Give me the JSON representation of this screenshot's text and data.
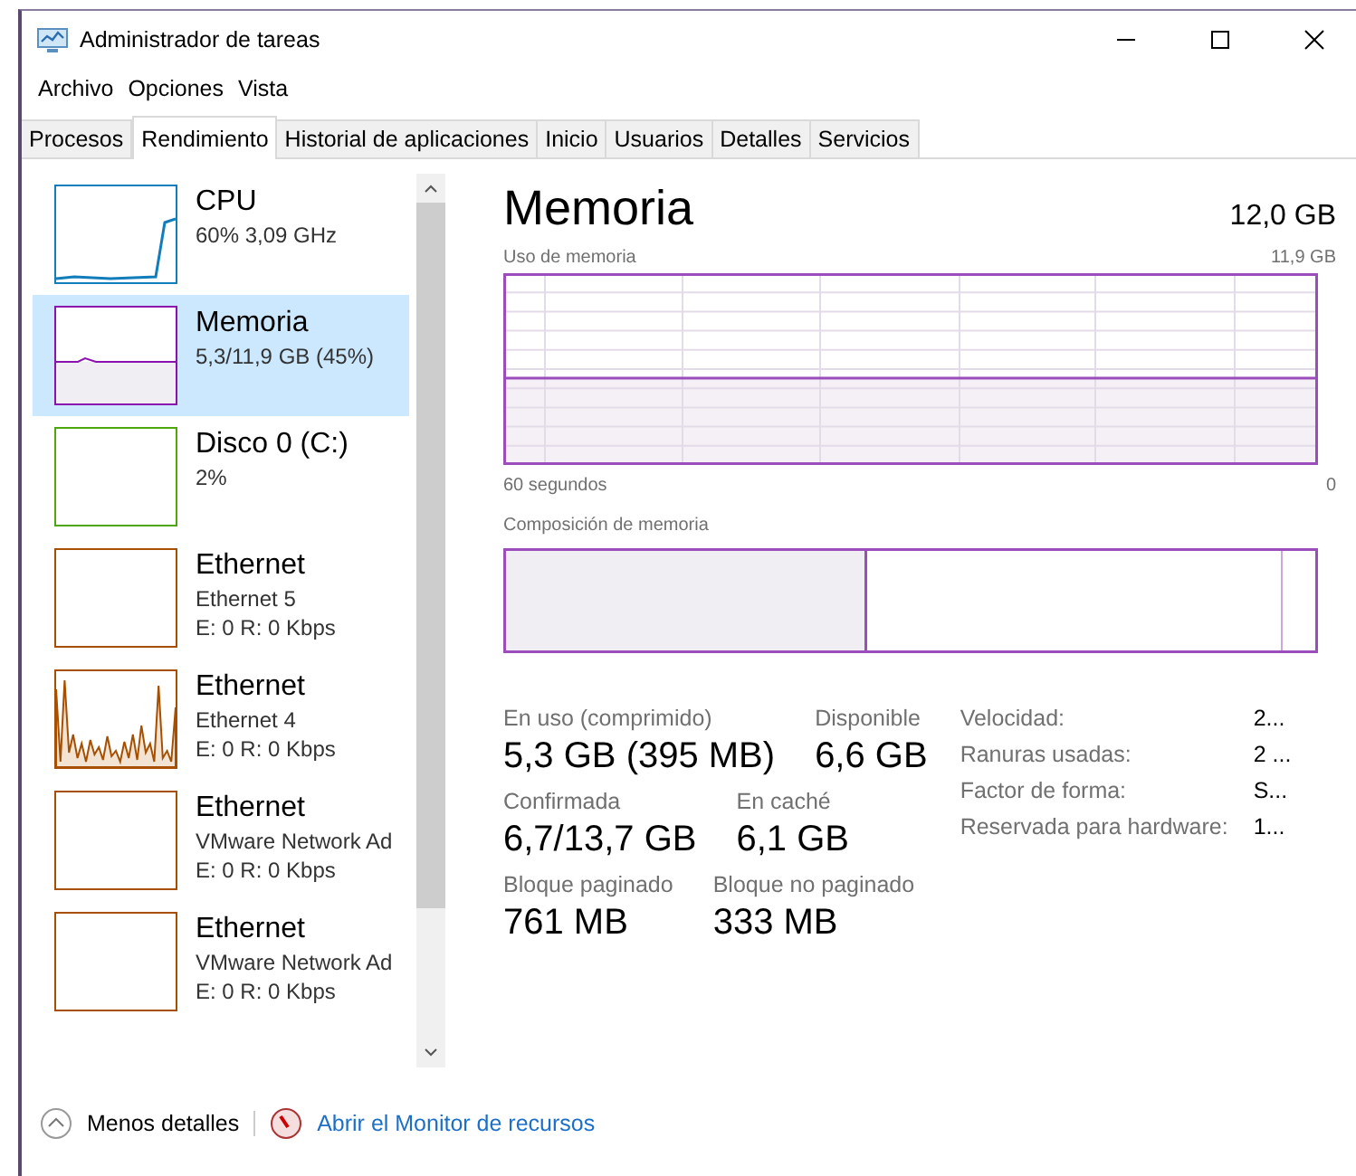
{
  "window": {
    "title": "Administrador de tareas"
  },
  "menu": [
    "Archivo",
    "Opciones",
    "Vista"
  ],
  "tabs": [
    {
      "label": "Procesos",
      "selected": false
    },
    {
      "label": "Rendimiento",
      "selected": true
    },
    {
      "label": "Historial de aplicaciones",
      "selected": false
    },
    {
      "label": "Inicio",
      "selected": false
    },
    {
      "label": "Usuarios",
      "selected": false
    },
    {
      "label": "Detalles",
      "selected": false
    },
    {
      "label": "Servicios",
      "selected": false
    }
  ],
  "sidebar": {
    "items": [
      {
        "name": "CPU",
        "lines": [
          "60% 3,09 GHz"
        ],
        "color": "#117dbb",
        "kind": "rise",
        "selected": false
      },
      {
        "name": "Memoria",
        "lines": [
          "5,3/11,9 GB (45%)"
        ],
        "color": "#8b12ae",
        "kind": "flat",
        "selected": true
      },
      {
        "name": "Disco 0 (C:)",
        "lines": [
          "2%"
        ],
        "color": "#4da60c",
        "kind": "empty",
        "selected": false
      },
      {
        "name": "Ethernet",
        "lines": [
          "Ethernet 5",
          "E: 0 R: 0 Kbps"
        ],
        "color": "#a74f01",
        "kind": "empty",
        "selected": false
      },
      {
        "name": "Ethernet",
        "lines": [
          "Ethernet 4",
          "E: 0 R: 0 Kbps"
        ],
        "color": "#a74f01",
        "kind": "spiky",
        "selected": false
      },
      {
        "name": "Ethernet",
        "lines": [
          "VMware Network Ad",
          "E: 0 R: 0 Kbps"
        ],
        "color": "#a74f01",
        "kind": "empty",
        "selected": false
      },
      {
        "name": "Ethernet",
        "lines": [
          "VMware Network Ad",
          "E: 0 R: 0 Kbps"
        ],
        "color": "#a74f01",
        "kind": "empty",
        "selected": false
      }
    ]
  },
  "detail": {
    "title": "Memoria",
    "total": "12,0 GB",
    "usage_label": "Uso de memoria",
    "usage_max": "11,9 GB",
    "time_span": "60 segundos",
    "time_end": "0",
    "composition_label": "Composición de memoria",
    "composition": {
      "level": 0.445
    },
    "stats": [
      [
        {
          "label": "En uso (comprimido)",
          "value": "5,3 GB (395 MB)"
        },
        {
          "label": "Disponible",
          "value": "6,6 GB"
        }
      ],
      [
        {
          "label": "Confirmada",
          "value": "6,7/13,7 GB"
        },
        {
          "label": "En caché",
          "value": "6,1 GB"
        }
      ],
      [
        {
          "label": "Bloque paginado",
          "value": "761 MB"
        },
        {
          "label": "Bloque no paginado",
          "value": "333 MB"
        }
      ]
    ],
    "properties": [
      {
        "label": "Velocidad:",
        "value": "2..."
      },
      {
        "label": "Ranuras usadas:",
        "value": "2 ..."
      },
      {
        "label": "Factor de forma:",
        "value": "S..."
      },
      {
        "label": "Reservada para hardware:",
        "value": "1..."
      }
    ]
  },
  "footer": {
    "fewer_details": "Menos detalles",
    "monitor_link": "Abrir el Monitor de recursos"
  }
}
